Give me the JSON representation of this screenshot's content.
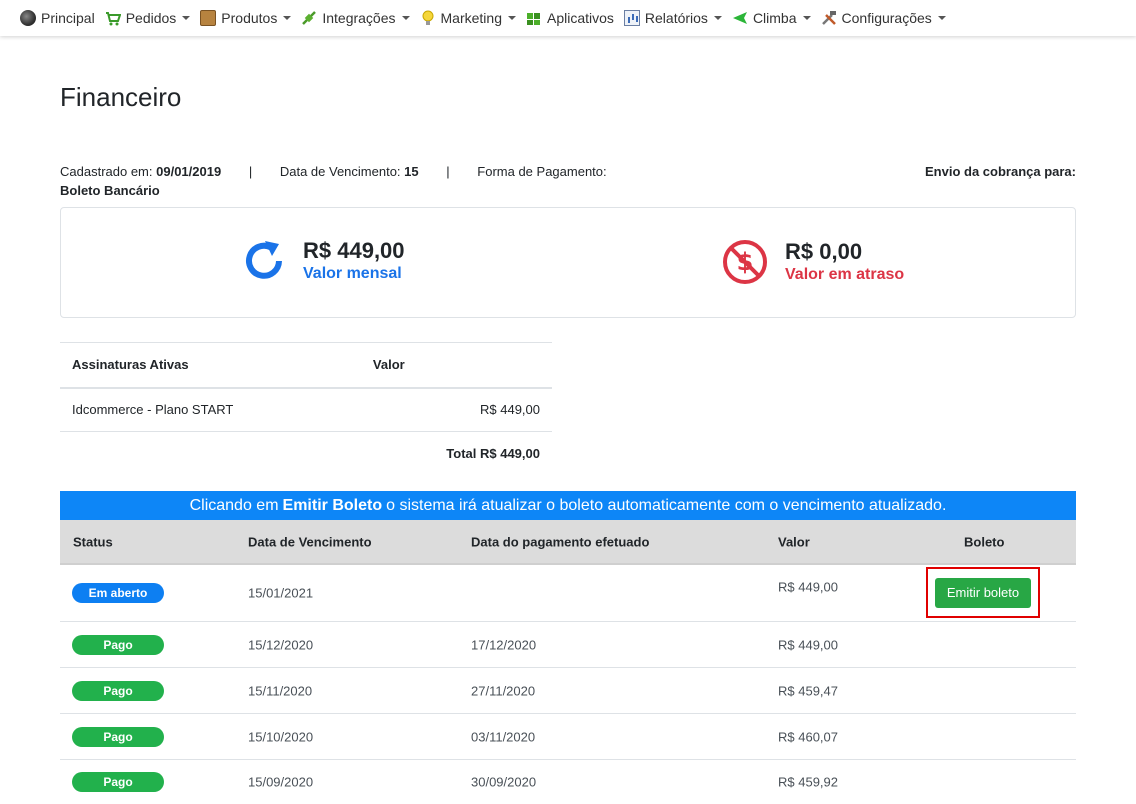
{
  "nav": {
    "items": [
      {
        "label": "Principal",
        "icon": "home-icon",
        "dropdown": false
      },
      {
        "label": "Pedidos",
        "icon": "cart-icon",
        "dropdown": true
      },
      {
        "label": "Produtos",
        "icon": "box-icon",
        "dropdown": true
      },
      {
        "label": "Integrações",
        "icon": "plug-icon",
        "dropdown": true
      },
      {
        "label": "Marketing",
        "icon": "lightbulb-icon",
        "dropdown": true
      },
      {
        "label": "Aplicativos",
        "icon": "puzzle-icon",
        "dropdown": false
      },
      {
        "label": "Relatórios",
        "icon": "chart-icon",
        "dropdown": true
      },
      {
        "label": "Climba",
        "icon": "flag-icon",
        "dropdown": true
      },
      {
        "label": "Configurações",
        "icon": "tools-icon",
        "dropdown": true
      }
    ]
  },
  "page": {
    "title": "Financeiro"
  },
  "info": {
    "registered_label": "Cadastrado em:",
    "registered_value": "09/01/2019",
    "separator": "|",
    "due_label": "Data de Vencimento:",
    "due_value": "15",
    "payment_label": "Forma de Pagamento:",
    "payment_value": "Boleto Bancário",
    "billing_label": "Envio da cobrança para:"
  },
  "summary": {
    "monthly_amount": "R$ 449,00",
    "monthly_label": "Valor mensal",
    "overdue_amount": "R$ 0,00",
    "overdue_label": "Valor em atraso",
    "monthly_color": "#1a73e8",
    "overdue_color": "#dc3545"
  },
  "subscriptions": {
    "header_name": "Assinaturas Ativas",
    "header_value": "Valor",
    "rows": [
      {
        "name": "Idcommerce - Plano START",
        "value": "R$ 449,00"
      }
    ],
    "total": "Total R$ 449,00"
  },
  "banner": {
    "prefix": "Clicando em",
    "highlight": "Emitir Boleto",
    "suffix": "o sistema irá atualizar o boleto automaticamente com o vencimento atualizado.",
    "color": "#0d86f7"
  },
  "payments": {
    "headers": {
      "status": "Status",
      "due": "Data de Vencimento",
      "paid": "Data do pagamento efetuado",
      "value": "Valor",
      "boleto": "Boleto"
    },
    "emit_label": "Emitir boleto",
    "rows": [
      {
        "status": "Em aberto",
        "due": "15/01/2021",
        "paid": "",
        "value": "R$ 449,00"
      },
      {
        "status": "Pago",
        "due": "15/12/2020",
        "paid": "17/12/2020",
        "value": "R$ 449,00"
      },
      {
        "status": "Pago",
        "due": "15/11/2020",
        "paid": "27/11/2020",
        "value": "R$ 459,47"
      },
      {
        "status": "Pago",
        "due": "15/10/2020",
        "paid": "03/11/2020",
        "value": "R$ 460,07"
      },
      {
        "status": "Pago",
        "due": "15/09/2020",
        "paid": "30/09/2020",
        "value": "R$ 459,92"
      }
    ]
  }
}
